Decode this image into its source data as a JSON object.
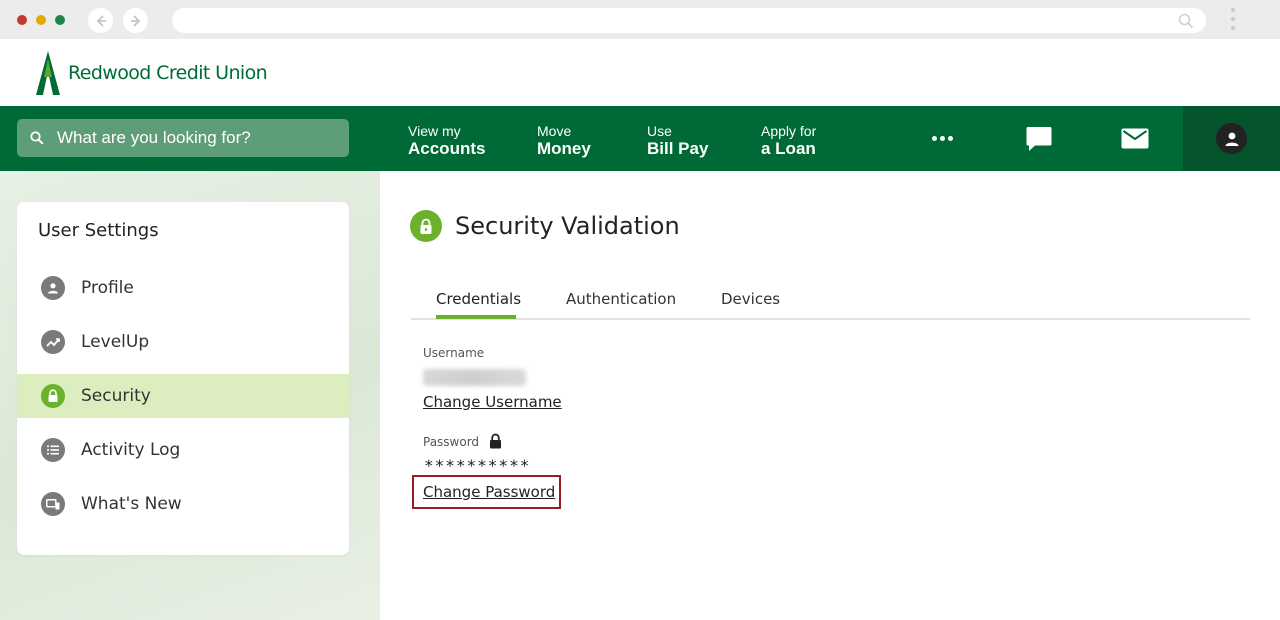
{
  "brand": {
    "name": "Redwood Credit Union",
    "primary_color": "#006a37",
    "accent_color": "#6cb12b"
  },
  "browser": {
    "url": ""
  },
  "search": {
    "placeholder": "What are you looking for?"
  },
  "nav": [
    {
      "line1": "View my",
      "line2": "Accounts"
    },
    {
      "line1": "Move",
      "line2": "Money"
    },
    {
      "line1": "Use",
      "line2": "Bill Pay"
    },
    {
      "line1": "Apply for",
      "line2": "a Loan"
    }
  ],
  "nav_icons": [
    "more-icon",
    "chat-icon",
    "mail-icon",
    "user-icon"
  ],
  "sidebar": {
    "title": "User Settings",
    "items": [
      {
        "label": "Profile",
        "icon": "user-icon",
        "active": false
      },
      {
        "label": "LevelUp",
        "icon": "trend-icon",
        "active": false
      },
      {
        "label": "Security",
        "icon": "lock-icon",
        "active": true
      },
      {
        "label": "Activity Log",
        "icon": "list-icon",
        "active": false
      },
      {
        "label": "What's New",
        "icon": "devices-icon",
        "active": false
      }
    ]
  },
  "main": {
    "title": "Security Validation",
    "tabs": [
      {
        "label": "Credentials",
        "active": true
      },
      {
        "label": "Authentication",
        "active": false
      },
      {
        "label": "Devices",
        "active": false
      }
    ],
    "username": {
      "label": "Username",
      "change_link": "Change Username"
    },
    "password": {
      "label": "Password",
      "value": "**********",
      "change_link": "Change Password"
    }
  }
}
